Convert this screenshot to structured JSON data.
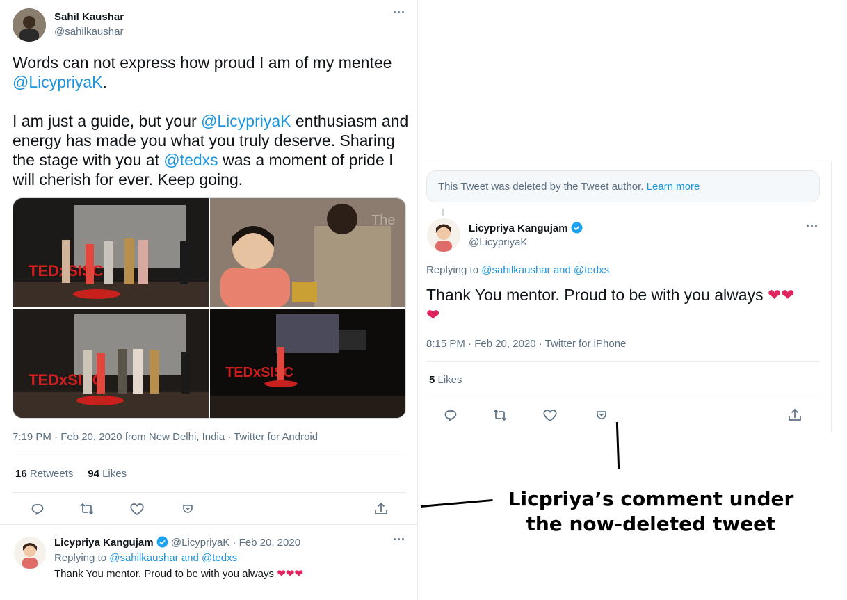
{
  "main_tweet": {
    "author_name": "Sahil Kaushar",
    "author_handle": "@sahilkaushar",
    "text_p1_a": "Words can not express how proud I am of my mentee ",
    "text_p1_mention": "@LicypriyaK",
    "text_p1_b": ".",
    "text_p2_a": "I am just a guide, but your ",
    "text_p2_mention1": "@LicypriyaK",
    "text_p2_b": " enthusiasm and energy has made you what you truly deserve. Sharing the stage with you at ",
    "text_p2_mention2": "@tedxs",
    "text_p2_c": " was a moment of pride I will cherish for ever. Keep going.",
    "meta": "7:19 PM · Feb 20, 2020 from New Delhi, India · Twitter for Android",
    "retweets_count": "16",
    "retweets_label": " Retweets",
    "likes_count": "94",
    "likes_label": " Likes",
    "photo_text_1": "TEDxSISC",
    "photo_text_2": "The",
    "photo_text_3": "TEDxSISC",
    "photo_text_4": "TEDxSISC"
  },
  "reply_small": {
    "author_name": "Licypriya Kangujam",
    "handle_date": " @LicypriyaK · Feb 20, 2020",
    "replying_label": "Replying to ",
    "replying_to": "@sahilkaushar and @tedxs",
    "text": "Thank You mentor. Proud to be with you always ",
    "hearts": "❤❤❤"
  },
  "reply_detail": {
    "deleted_notice": "This Tweet was deleted by the Tweet author. ",
    "learn_more": "Learn more",
    "author_name": "Licypriya Kangujam",
    "author_handle": "@LicypriyaK",
    "replying_label": "Replying to ",
    "replying_to": "@sahilkaushar and @tedxs",
    "text": "Thank You mentor. Proud to be with you always ",
    "hearts_line1": "❤❤",
    "hearts_line2": "❤",
    "meta": "8:15 PM · Feb 20, 2020 · Twitter for iPhone",
    "likes_count": "5",
    "likes_label": " Likes"
  },
  "annotation": {
    "line1": "Licpriya’s comment under",
    "line2": "the now-deleted tweet"
  },
  "colors": {
    "link": "#1b95e0",
    "muted": "#5b7083",
    "heart": "#e0245e",
    "verified": "#1da1f2"
  },
  "icons": [
    "reply-icon",
    "retweet-icon",
    "like-icon",
    "bookmark-icon",
    "share-icon",
    "more-icon",
    "verified-badge-icon"
  ]
}
